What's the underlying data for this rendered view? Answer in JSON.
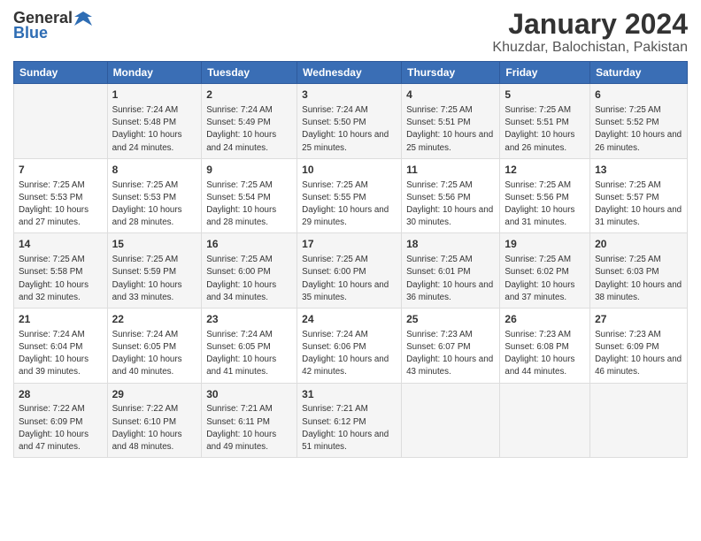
{
  "logo": {
    "general": "General",
    "blue": "Blue"
  },
  "title": "January 2024",
  "subtitle": "Khuzdar, Balochistan, Pakistan",
  "days_of_week": [
    "Sunday",
    "Monday",
    "Tuesday",
    "Wednesday",
    "Thursday",
    "Friday",
    "Saturday"
  ],
  "weeks": [
    [
      {
        "day": "",
        "sunrise": "",
        "sunset": "",
        "daylight": ""
      },
      {
        "day": "1",
        "sunrise": "Sunrise: 7:24 AM",
        "sunset": "Sunset: 5:48 PM",
        "daylight": "Daylight: 10 hours and 24 minutes."
      },
      {
        "day": "2",
        "sunrise": "Sunrise: 7:24 AM",
        "sunset": "Sunset: 5:49 PM",
        "daylight": "Daylight: 10 hours and 24 minutes."
      },
      {
        "day": "3",
        "sunrise": "Sunrise: 7:24 AM",
        "sunset": "Sunset: 5:50 PM",
        "daylight": "Daylight: 10 hours and 25 minutes."
      },
      {
        "day": "4",
        "sunrise": "Sunrise: 7:25 AM",
        "sunset": "Sunset: 5:51 PM",
        "daylight": "Daylight: 10 hours and 25 minutes."
      },
      {
        "day": "5",
        "sunrise": "Sunrise: 7:25 AM",
        "sunset": "Sunset: 5:51 PM",
        "daylight": "Daylight: 10 hours and 26 minutes."
      },
      {
        "day": "6",
        "sunrise": "Sunrise: 7:25 AM",
        "sunset": "Sunset: 5:52 PM",
        "daylight": "Daylight: 10 hours and 26 minutes."
      }
    ],
    [
      {
        "day": "7",
        "sunrise": "Sunrise: 7:25 AM",
        "sunset": "Sunset: 5:53 PM",
        "daylight": "Daylight: 10 hours and 27 minutes."
      },
      {
        "day": "8",
        "sunrise": "Sunrise: 7:25 AM",
        "sunset": "Sunset: 5:53 PM",
        "daylight": "Daylight: 10 hours and 28 minutes."
      },
      {
        "day": "9",
        "sunrise": "Sunrise: 7:25 AM",
        "sunset": "Sunset: 5:54 PM",
        "daylight": "Daylight: 10 hours and 28 minutes."
      },
      {
        "day": "10",
        "sunrise": "Sunrise: 7:25 AM",
        "sunset": "Sunset: 5:55 PM",
        "daylight": "Daylight: 10 hours and 29 minutes."
      },
      {
        "day": "11",
        "sunrise": "Sunrise: 7:25 AM",
        "sunset": "Sunset: 5:56 PM",
        "daylight": "Daylight: 10 hours and 30 minutes."
      },
      {
        "day": "12",
        "sunrise": "Sunrise: 7:25 AM",
        "sunset": "Sunset: 5:56 PM",
        "daylight": "Daylight: 10 hours and 31 minutes."
      },
      {
        "day": "13",
        "sunrise": "Sunrise: 7:25 AM",
        "sunset": "Sunset: 5:57 PM",
        "daylight": "Daylight: 10 hours and 31 minutes."
      }
    ],
    [
      {
        "day": "14",
        "sunrise": "Sunrise: 7:25 AM",
        "sunset": "Sunset: 5:58 PM",
        "daylight": "Daylight: 10 hours and 32 minutes."
      },
      {
        "day": "15",
        "sunrise": "Sunrise: 7:25 AM",
        "sunset": "Sunset: 5:59 PM",
        "daylight": "Daylight: 10 hours and 33 minutes."
      },
      {
        "day": "16",
        "sunrise": "Sunrise: 7:25 AM",
        "sunset": "Sunset: 6:00 PM",
        "daylight": "Daylight: 10 hours and 34 minutes."
      },
      {
        "day": "17",
        "sunrise": "Sunrise: 7:25 AM",
        "sunset": "Sunset: 6:00 PM",
        "daylight": "Daylight: 10 hours and 35 minutes."
      },
      {
        "day": "18",
        "sunrise": "Sunrise: 7:25 AM",
        "sunset": "Sunset: 6:01 PM",
        "daylight": "Daylight: 10 hours and 36 minutes."
      },
      {
        "day": "19",
        "sunrise": "Sunrise: 7:25 AM",
        "sunset": "Sunset: 6:02 PM",
        "daylight": "Daylight: 10 hours and 37 minutes."
      },
      {
        "day": "20",
        "sunrise": "Sunrise: 7:25 AM",
        "sunset": "Sunset: 6:03 PM",
        "daylight": "Daylight: 10 hours and 38 minutes."
      }
    ],
    [
      {
        "day": "21",
        "sunrise": "Sunrise: 7:24 AM",
        "sunset": "Sunset: 6:04 PM",
        "daylight": "Daylight: 10 hours and 39 minutes."
      },
      {
        "day": "22",
        "sunrise": "Sunrise: 7:24 AM",
        "sunset": "Sunset: 6:05 PM",
        "daylight": "Daylight: 10 hours and 40 minutes."
      },
      {
        "day": "23",
        "sunrise": "Sunrise: 7:24 AM",
        "sunset": "Sunset: 6:05 PM",
        "daylight": "Daylight: 10 hours and 41 minutes."
      },
      {
        "day": "24",
        "sunrise": "Sunrise: 7:24 AM",
        "sunset": "Sunset: 6:06 PM",
        "daylight": "Daylight: 10 hours and 42 minutes."
      },
      {
        "day": "25",
        "sunrise": "Sunrise: 7:23 AM",
        "sunset": "Sunset: 6:07 PM",
        "daylight": "Daylight: 10 hours and 43 minutes."
      },
      {
        "day": "26",
        "sunrise": "Sunrise: 7:23 AM",
        "sunset": "Sunset: 6:08 PM",
        "daylight": "Daylight: 10 hours and 44 minutes."
      },
      {
        "day": "27",
        "sunrise": "Sunrise: 7:23 AM",
        "sunset": "Sunset: 6:09 PM",
        "daylight": "Daylight: 10 hours and 46 minutes."
      }
    ],
    [
      {
        "day": "28",
        "sunrise": "Sunrise: 7:22 AM",
        "sunset": "Sunset: 6:09 PM",
        "daylight": "Daylight: 10 hours and 47 minutes."
      },
      {
        "day": "29",
        "sunrise": "Sunrise: 7:22 AM",
        "sunset": "Sunset: 6:10 PM",
        "daylight": "Daylight: 10 hours and 48 minutes."
      },
      {
        "day": "30",
        "sunrise": "Sunrise: 7:21 AM",
        "sunset": "Sunset: 6:11 PM",
        "daylight": "Daylight: 10 hours and 49 minutes."
      },
      {
        "day": "31",
        "sunrise": "Sunrise: 7:21 AM",
        "sunset": "Sunset: 6:12 PM",
        "daylight": "Daylight: 10 hours and 51 minutes."
      },
      {
        "day": "",
        "sunrise": "",
        "sunset": "",
        "daylight": ""
      },
      {
        "day": "",
        "sunrise": "",
        "sunset": "",
        "daylight": ""
      },
      {
        "day": "",
        "sunrise": "",
        "sunset": "",
        "daylight": ""
      }
    ]
  ]
}
